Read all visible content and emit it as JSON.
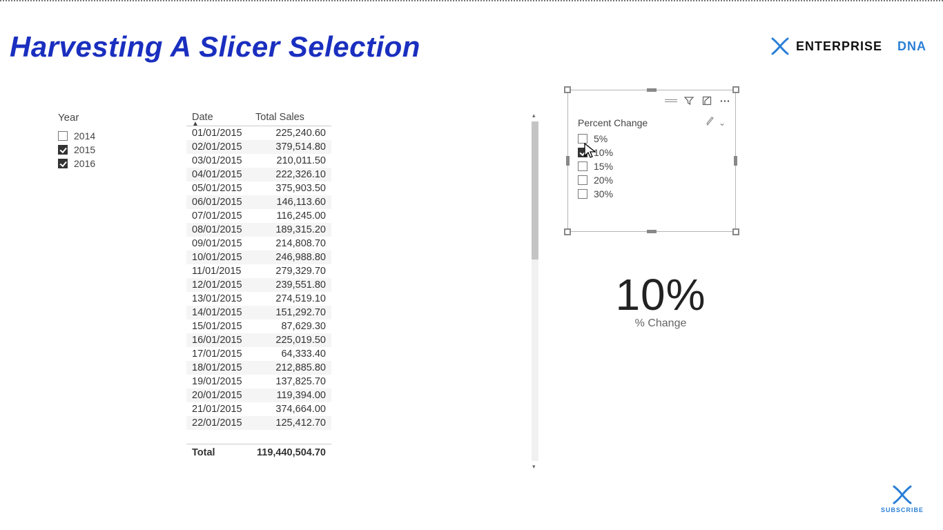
{
  "title": "Harvesting A Slicer Selection",
  "brand": {
    "part1": "ENTERPRISE",
    "part2": "DNA"
  },
  "year_slicer": {
    "header": "Year",
    "items": [
      {
        "label": "2014",
        "checked": false
      },
      {
        "label": "2015",
        "checked": true
      },
      {
        "label": "2016",
        "checked": true
      }
    ]
  },
  "table": {
    "columns": [
      "Date",
      "Total Sales"
    ],
    "rows": [
      {
        "date": "01/01/2015",
        "total": "225,240.60"
      },
      {
        "date": "02/01/2015",
        "total": "379,514.80"
      },
      {
        "date": "03/01/2015",
        "total": "210,011.50"
      },
      {
        "date": "04/01/2015",
        "total": "222,326.10"
      },
      {
        "date": "05/01/2015",
        "total": "375,903.50"
      },
      {
        "date": "06/01/2015",
        "total": "146,113.60"
      },
      {
        "date": "07/01/2015",
        "total": "116,245.00"
      },
      {
        "date": "08/01/2015",
        "total": "189,315.20"
      },
      {
        "date": "09/01/2015",
        "total": "214,808.70"
      },
      {
        "date": "10/01/2015",
        "total": "246,988.80"
      },
      {
        "date": "11/01/2015",
        "total": "279,329.70"
      },
      {
        "date": "12/01/2015",
        "total": "239,551.80"
      },
      {
        "date": "13/01/2015",
        "total": "274,519.10"
      },
      {
        "date": "14/01/2015",
        "total": "151,292.70"
      },
      {
        "date": "15/01/2015",
        "total": "87,629.30"
      },
      {
        "date": "16/01/2015",
        "total": "225,019.50"
      },
      {
        "date": "17/01/2015",
        "total": "64,333.40"
      },
      {
        "date": "18/01/2015",
        "total": "212,885.80"
      },
      {
        "date": "19/01/2015",
        "total": "137,825.70"
      },
      {
        "date": "20/01/2015",
        "total": "119,394.00"
      },
      {
        "date": "21/01/2015",
        "total": "374,664.00"
      },
      {
        "date": "22/01/2015",
        "total": "125,412.70"
      }
    ],
    "total_label": "Total",
    "total_value": "119,440,504.70"
  },
  "pct_slicer": {
    "header": "Percent Change",
    "items": [
      {
        "label": "5%",
        "checked": false
      },
      {
        "label": "10%",
        "checked": true
      },
      {
        "label": "15%",
        "checked": false
      },
      {
        "label": "20%",
        "checked": false
      },
      {
        "label": "30%",
        "checked": false
      }
    ]
  },
  "card": {
    "value": "10%",
    "label": "% Change"
  },
  "subscribe": "SUBSCRIBE"
}
